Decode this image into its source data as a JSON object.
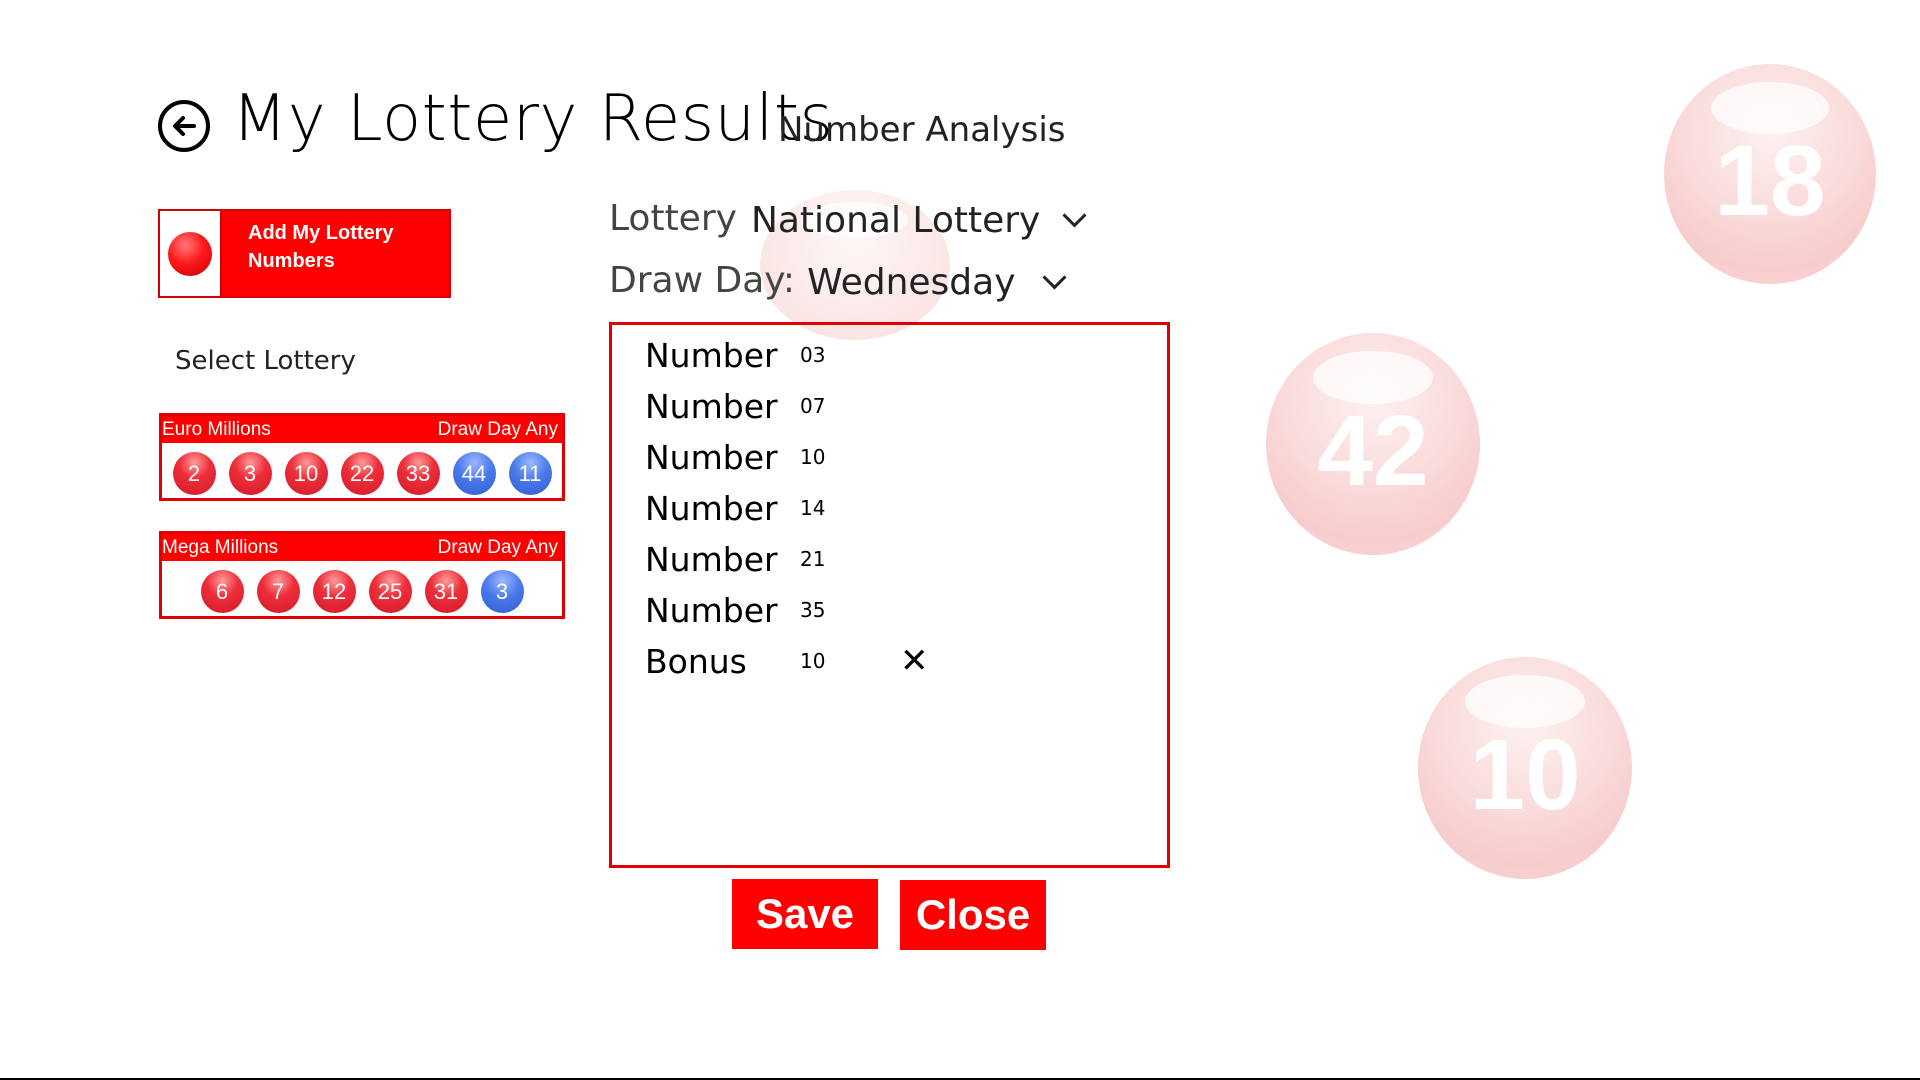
{
  "header": {
    "title": "My Lottery Results",
    "subtitle": "Number Analysis",
    "back_icon": "back-arrow-icon"
  },
  "add_button": {
    "label": "Add My Lottery Numbers",
    "icon": "red-ball-icon"
  },
  "select_label": "Select Lottery",
  "lotteries": [
    {
      "name": "Euro Millions",
      "draw_day": "Draw Day Any",
      "balls": [
        {
          "value": "2",
          "color": "red"
        },
        {
          "value": "3",
          "color": "red"
        },
        {
          "value": "10",
          "color": "red"
        },
        {
          "value": "22",
          "color": "red"
        },
        {
          "value": "33",
          "color": "red"
        },
        {
          "value": "44",
          "color": "blue"
        },
        {
          "value": "11",
          "color": "blue"
        }
      ]
    },
    {
      "name": "Mega Millions",
      "draw_day": "Draw Day Any",
      "balls": [
        {
          "value": "6",
          "color": "red"
        },
        {
          "value": "7",
          "color": "red"
        },
        {
          "value": "12",
          "color": "red"
        },
        {
          "value": "25",
          "color": "red"
        },
        {
          "value": "31",
          "color": "red"
        },
        {
          "value": "3",
          "color": "blue"
        }
      ]
    }
  ],
  "lottery_select": {
    "label": "Lottery",
    "value": "National Lottery"
  },
  "draw_day_select": {
    "label": "Draw Day:",
    "value": "Wednesday"
  },
  "numbers": [
    {
      "label": "Number",
      "value": "03"
    },
    {
      "label": "Number",
      "value": "07"
    },
    {
      "label": "Number",
      "value": "10"
    },
    {
      "label": "Number",
      "value": "14"
    },
    {
      "label": "Number",
      "value": "21"
    },
    {
      "label": "Number",
      "value": "35"
    },
    {
      "label": "Bonus",
      "value": "10",
      "remove": "✕"
    }
  ],
  "buttons": {
    "save": "Save",
    "close": "Close"
  },
  "background_balls": [
    "18",
    "42",
    "10"
  ],
  "colors": {
    "accent": "#ff0000",
    "ball_red": "#e8323c",
    "ball_blue": "#4a79ea"
  }
}
